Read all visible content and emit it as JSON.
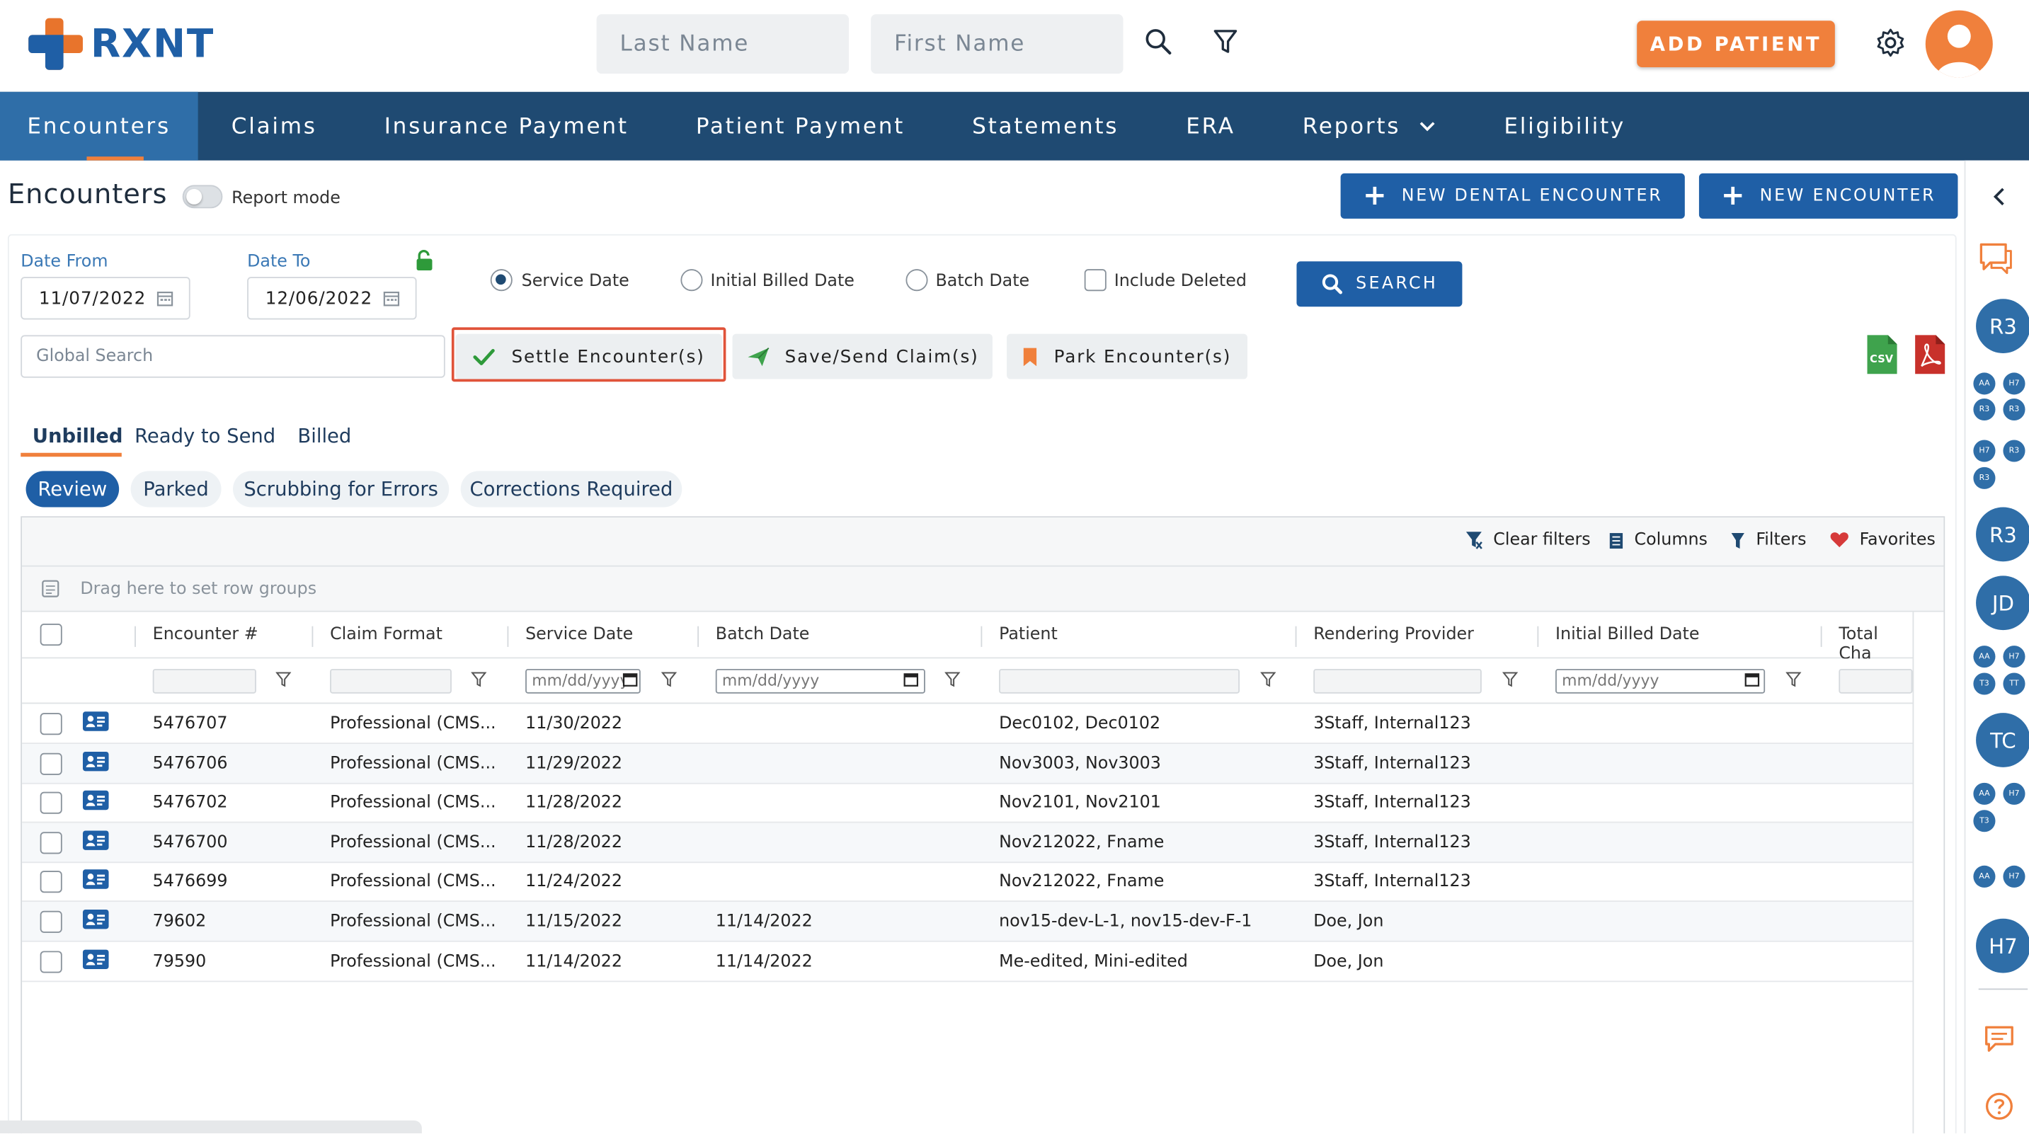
{
  "header": {
    "logo_text": "RXNT",
    "last_name_placeholder": "Last Name",
    "first_name_placeholder": "First Name",
    "add_patient_label": "ADD PATIENT"
  },
  "nav": {
    "items": [
      "Encounters",
      "Claims",
      "Insurance Payment",
      "Patient Payment",
      "Statements",
      "ERA",
      "Reports",
      "Eligibility"
    ],
    "active": "Encounters"
  },
  "page": {
    "title": "Encounters",
    "report_mode_label": "Report mode",
    "new_dental_label": "NEW DENTAL ENCOUNTER",
    "new_encounter_label": "NEW ENCOUNTER"
  },
  "filters": {
    "date_from_label": "Date From",
    "date_from_value": "11/07/2022",
    "date_to_label": "Date To",
    "date_to_value": "12/06/2022",
    "radio_service": "Service Date",
    "radio_initial": "Initial Billed Date",
    "radio_batch": "Batch Date",
    "include_deleted": "Include Deleted",
    "search_label": "SEARCH",
    "global_search_placeholder": "Global Search"
  },
  "actions": {
    "settle": "Settle Encounter(s)",
    "save_send": "Save/Send Claim(s)",
    "park": "Park Encounter(s)",
    "csv_label": "CSV"
  },
  "tabs": {
    "unbilled": "Unbilled",
    "ready": "Ready to Send",
    "billed": "Billed"
  },
  "chips": {
    "review": "Review",
    "parked": "Parked",
    "scrubbing": "Scrubbing for Errors",
    "corrections": "Corrections Required"
  },
  "grid": {
    "toolbar": {
      "clear_filters": "Clear filters",
      "columns": "Columns",
      "filters": "Filters",
      "favorites": "Favorites"
    },
    "group_hint": "Drag here to set row groups",
    "headers": {
      "encounter": "Encounter #",
      "claim_format": "Claim Format",
      "service_date": "Service Date",
      "batch_date": "Batch Date",
      "patient": "Patient",
      "rendering_provider": "Rendering Provider",
      "initial_billed_date": "Initial Billed Date",
      "total": "Total Cha"
    },
    "date_placeholder": "mm/dd/yyyy",
    "date_placeholder_short": "mm/dd/yyyy",
    "rows": [
      {
        "encounter": "5476707",
        "format": "Professional (CMS...",
        "service": "11/30/2022",
        "batch": "",
        "patient": "Dec0102, Dec0102",
        "provider": "3Staff, Internal123"
      },
      {
        "encounter": "5476706",
        "format": "Professional (CMS...",
        "service": "11/29/2022",
        "batch": "",
        "patient": "Nov3003, Nov3003",
        "provider": "3Staff, Internal123"
      },
      {
        "encounter": "5476702",
        "format": "Professional (CMS...",
        "service": "11/28/2022",
        "batch": "",
        "patient": "Nov2101, Nov2101",
        "provider": "3Staff, Internal123"
      },
      {
        "encounter": "5476700",
        "format": "Professional (CMS...",
        "service": "11/28/2022",
        "batch": "",
        "patient": "Nov212022, Fname",
        "provider": "3Staff, Internal123"
      },
      {
        "encounter": "5476699",
        "format": "Professional (CMS...",
        "service": "11/24/2022",
        "batch": "",
        "patient": "Nov212022, Fname",
        "provider": "3Staff, Internal123"
      },
      {
        "encounter": "79602",
        "format": "Professional (CMS...",
        "service": "11/15/2022",
        "batch": "11/14/2022",
        "patient": "nov15-dev-L-1, nov15-dev-F-1",
        "provider": "Doe, Jon"
      },
      {
        "encounter": "79590",
        "format": "Professional (CMS...",
        "service": "11/14/2022",
        "batch": "11/14/2022",
        "patient": "Me-edited, Mini-edited",
        "provider": "Doe, Jon"
      }
    ]
  },
  "rail": {
    "b1": "R3",
    "b2": "R3",
    "b3": "JD",
    "b4": "TC",
    "b5": "H7",
    "s_aa": "AA",
    "s_h7": "H7",
    "s_r3": "R3",
    "s_t3": "T3",
    "s_tt": "TT"
  },
  "colors": {
    "brand_blue": "#1f5fa6",
    "nav_bg": "#1f4a72",
    "accent_orange": "#f0803c",
    "highlight_red": "#e0533a"
  }
}
